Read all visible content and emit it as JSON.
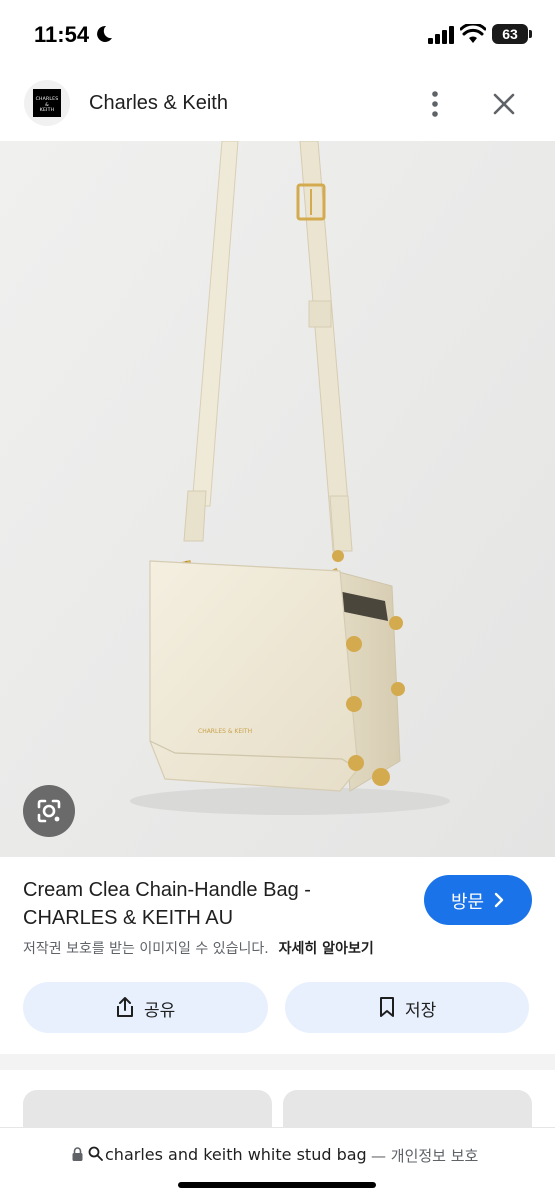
{
  "status_bar": {
    "time": "11:54",
    "battery": "63",
    "icons": [
      "moon-icon",
      "signal-icon",
      "wifi-icon",
      "battery-icon"
    ]
  },
  "header": {
    "site_name": "Charles & Keith",
    "logo_text": "CHARLES & KEITH",
    "icons": [
      "more-vert-icon",
      "close-icon"
    ]
  },
  "image": {
    "description_icon": "lens-icon",
    "bag_stamp": "CHARLES & KEITH"
  },
  "product": {
    "title": "Cream Clea Chain-Handle Bag - CHARLES & KEITH AU",
    "visit_label": "방문",
    "copyright_notice": "저작권 보호를 받는 이미지일 수 있습니다.",
    "learn_more": "자세히 알아보기"
  },
  "actions": {
    "share_label": "공유",
    "save_label": "저장"
  },
  "bottom_bar": {
    "query": "charles and keith white stud bag",
    "privacy": "— 개인정보 보호"
  },
  "colors": {
    "accent": "#1a73e8",
    "action_bg": "#e8f0fe",
    "bag": "#efe9d7",
    "gold": "#d4aa4e"
  }
}
